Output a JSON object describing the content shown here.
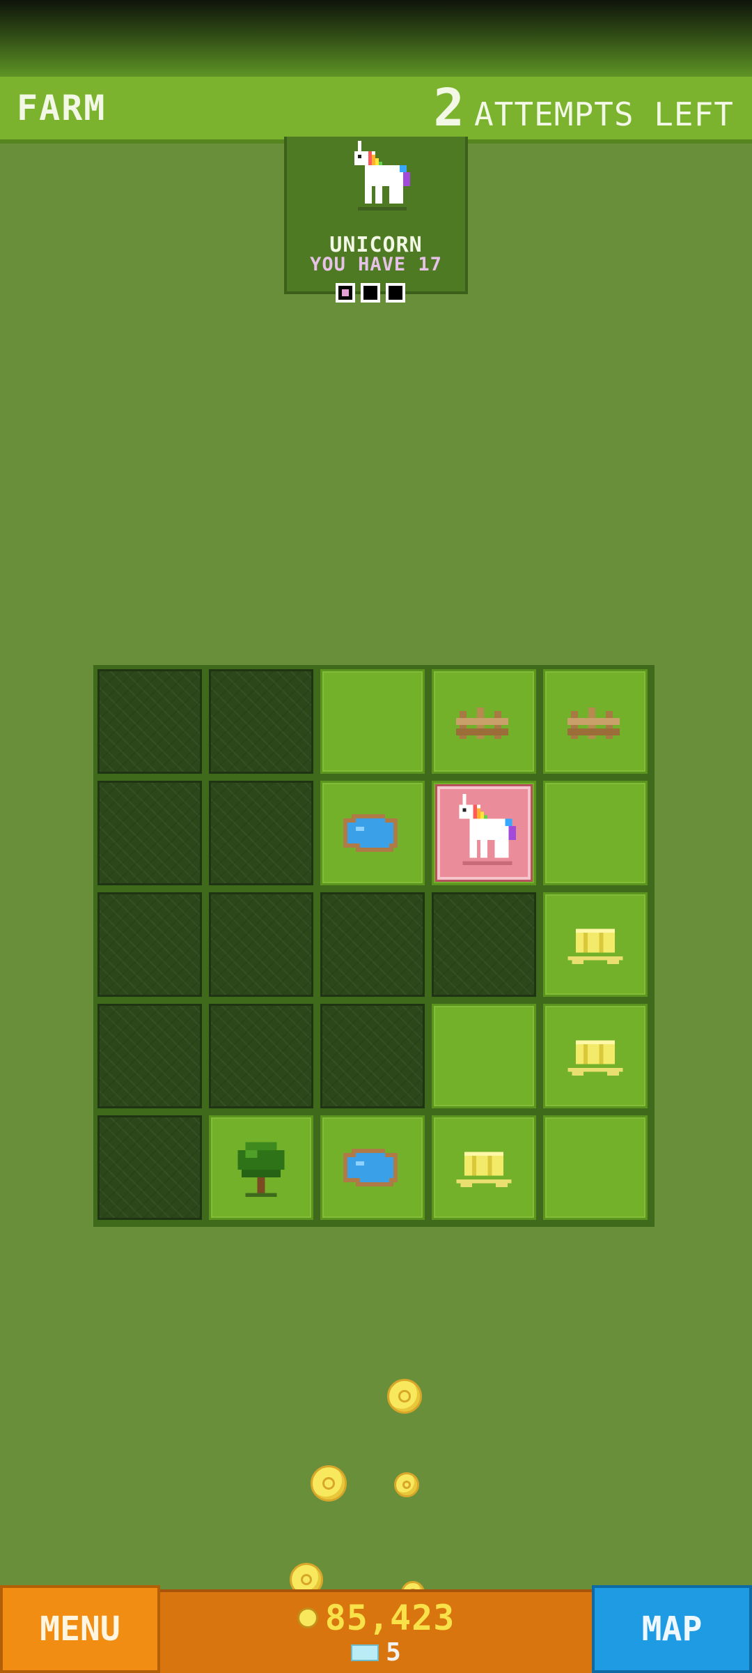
{
  "header": {
    "title": "FARM",
    "attempts_count": "2",
    "attempts_label": "ATTEMPTS LEFT"
  },
  "card": {
    "animal": "UNICORN",
    "owned_text": "YOU HAVE 17",
    "progress_filled": 1,
    "progress_total": 3
  },
  "board": {
    "rows": 5,
    "cols": 5,
    "tiles": [
      [
        "hidden",
        "hidden",
        "grass",
        "fence",
        "fence"
      ],
      [
        "hidden",
        "hidden",
        "pond",
        "unicorn",
        "grass"
      ],
      [
        "hidden",
        "hidden",
        "hidden",
        "hidden",
        "hay"
      ],
      [
        "hidden",
        "hidden",
        "hidden",
        "grass",
        "hay"
      ],
      [
        "hidden",
        "tree",
        "pond",
        "hay",
        "grass"
      ]
    ]
  },
  "footer": {
    "menu_label": "MENU",
    "map_label": "MAP",
    "coins": "85,423",
    "gems": "5"
  },
  "colors": {
    "background": "#6a8f3a",
    "header_green": "#7cb32e",
    "menu_orange": "#f08d12",
    "map_blue": "#1e9be3",
    "coin_yellow": "#f9e14a"
  }
}
